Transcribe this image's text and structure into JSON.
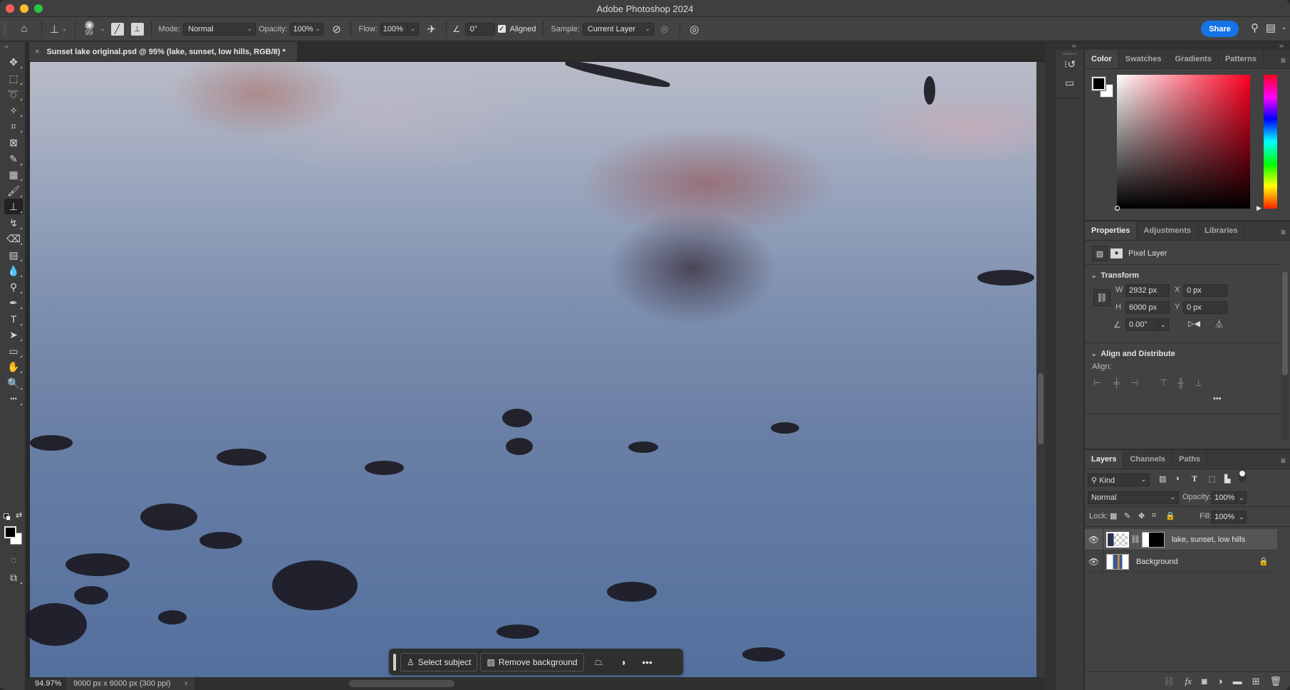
{
  "app": {
    "title": "Adobe Photoshop 2024"
  },
  "options_bar": {
    "tool_icon": "clone-stamp-icon",
    "brush_size": "99",
    "mode_label": "Mode:",
    "mode_value": "Normal",
    "opacity_label": "Opacity:",
    "opacity_value": "100%",
    "flow_label": "Flow:",
    "flow_value": "100%",
    "angle_value": "0°",
    "aligned_label": "Aligned",
    "aligned_checked": true,
    "sample_label": "Sample:",
    "sample_value": "Current Layer",
    "share_label": "Share"
  },
  "document": {
    "tab_title": "Sunset lake original.psd @ 95% (lake, sunset, low hills, RGB/8) *",
    "close_glyph": "×"
  },
  "status_bar": {
    "zoom": "94.97%",
    "doc_info": "9000 px x 6000 px (300 ppi)",
    "arrow": "›"
  },
  "contextual_task_bar": {
    "select_subject": "Select subject",
    "remove_background": "Remove background"
  },
  "tools": [
    {
      "name": "move-tool",
      "glyph": "✥"
    },
    {
      "name": "rectangular-marquee-tool",
      "glyph": "⬚"
    },
    {
      "name": "lasso-tool",
      "glyph": "➰"
    },
    {
      "name": "magic-wand-tool",
      "glyph": "✧"
    },
    {
      "name": "crop-tool",
      "glyph": "⌗"
    },
    {
      "name": "frame-tool",
      "glyph": "⊠"
    },
    {
      "name": "eyedropper-tool",
      "glyph": "✎"
    },
    {
      "name": "spot-healing-tool",
      "glyph": "▦"
    },
    {
      "name": "brush-tool",
      "glyph": "🖌"
    },
    {
      "name": "clone-stamp-tool",
      "glyph": "⊥",
      "active": true
    },
    {
      "name": "history-brush-tool",
      "glyph": "↯"
    },
    {
      "name": "eraser-tool",
      "glyph": "⌫"
    },
    {
      "name": "gradient-tool",
      "glyph": "▤"
    },
    {
      "name": "blur-tool",
      "glyph": "💧"
    },
    {
      "name": "dodge-tool",
      "glyph": "⚲"
    },
    {
      "name": "pen-tool",
      "glyph": "✒"
    },
    {
      "name": "type-tool",
      "glyph": "T"
    },
    {
      "name": "path-selection-tool",
      "glyph": "➤"
    },
    {
      "name": "rectangle-tool",
      "glyph": "▭"
    },
    {
      "name": "hand-tool",
      "glyph": "✋"
    },
    {
      "name": "zoom-tool",
      "glyph": "🔍"
    },
    {
      "name": "edit-toolbar",
      "glyph": "•••"
    }
  ],
  "color_panel": {
    "tabs": [
      "Color",
      "Swatches",
      "Gradients",
      "Patterns"
    ],
    "active_tab": "Color",
    "foreground": "#000000",
    "background": "#ffffff",
    "hue": "#ff0020"
  },
  "properties_panel": {
    "tabs": [
      "Properties",
      "Adjustments",
      "Libraries"
    ],
    "active_tab": "Properties",
    "layer_type": "Pixel Layer",
    "transform": {
      "heading": "Transform",
      "w_label": "W",
      "w_value": "2932 px",
      "h_label": "H",
      "h_value": "6000 px",
      "x_label": "X",
      "x_value": "0 px",
      "y_label": "Y",
      "y_value": "0 px",
      "angle_value": "0.00°"
    },
    "align": {
      "heading": "Align and Distribute",
      "label": "Align:"
    }
  },
  "layers_panel": {
    "tabs": [
      "Layers",
      "Channels",
      "Paths"
    ],
    "active_tab": "Layers",
    "filter_kind": "Kind",
    "blend_mode": "Normal",
    "opacity_label": "Opacity:",
    "opacity_value": "100%",
    "lock_label": "Lock:",
    "fill_label": "Fill:",
    "fill_value": "100%",
    "layers": [
      {
        "name": "lake, sunset, low hills",
        "visible": true,
        "selected": true,
        "has_mask": true
      },
      {
        "name": "Background",
        "visible": true,
        "selected": false,
        "locked": true
      }
    ]
  }
}
